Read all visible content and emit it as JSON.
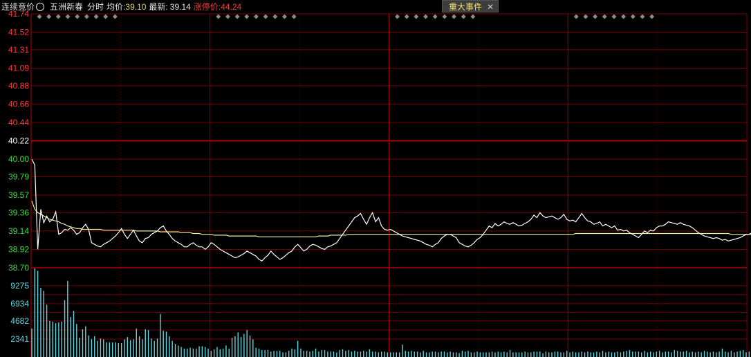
{
  "header": {
    "mode": "连续竞价",
    "stock_name": "五洲新春",
    "period": "分时",
    "avg_label": "均价:",
    "avg_value": "39.10",
    "last_label": "最新:",
    "last_value": "39.14",
    "limit_label": "涨停价:",
    "limit_value": "44.24",
    "event_button": "重大事件",
    "info_icon": "info-circle-icon",
    "close_icon": "close-icon"
  },
  "colors": {
    "up": "#ff3a3a",
    "down": "#3cdc3c",
    "neutral": "#ffffff",
    "price_line": "#ffffff",
    "avg_line": "#f0f0a0",
    "volume": "#5fd8e0",
    "grid": "#7a0000"
  },
  "chart_data": {
    "type": "line",
    "prev_close": 40.22,
    "price_ticks": [
      "41.74",
      "41.52",
      "41.31",
      "41.09",
      "40.88",
      "40.66",
      "40.44",
      "40.22",
      "40.00",
      "39.79",
      "39.57",
      "39.36",
      "39.14",
      "38.92",
      "38.70"
    ],
    "ylim": [
      38.7,
      41.74
    ],
    "volume_ticks": [
      "9275",
      "6934",
      "4682",
      "2341"
    ],
    "volume_ylim": [
      0,
      11600
    ],
    "minutes": 240,
    "series": [
      {
        "values": [
          40.0,
          39.93,
          38.92,
          39.4,
          39.24,
          39.32,
          39.25,
          39.28,
          39.37,
          39.1,
          39.12,
          39.16,
          39.15,
          39.18,
          39.15,
          39.1,
          39.12,
          39.18,
          39.22,
          39.16,
          39.0,
          38.98,
          38.96,
          38.95,
          38.98,
          39.0,
          39.02,
          39.05,
          39.08,
          39.12,
          39.17,
          39.1,
          39.05,
          39.1,
          39.15,
          39.08,
          39.02,
          39.0,
          39.05,
          39.06,
          39.1,
          39.12,
          39.14,
          39.18,
          39.2,
          39.14,
          39.1,
          39.05,
          39.02,
          39.0,
          38.98,
          38.95,
          38.95,
          38.98,
          39.0,
          38.97,
          38.95,
          38.95,
          38.92,
          38.95,
          39.0,
          38.98,
          38.95,
          38.92,
          38.9,
          38.88,
          38.86,
          38.84,
          38.82,
          38.83,
          38.85,
          38.87,
          38.9,
          38.88,
          38.86,
          38.84,
          38.8,
          38.78,
          38.82,
          38.85,
          38.9,
          38.86,
          38.83,
          38.8,
          38.82,
          38.85,
          38.88,
          38.9,
          38.95,
          38.98,
          38.94,
          38.9,
          38.92,
          38.96,
          38.98,
          38.97,
          38.95,
          38.93,
          38.92,
          38.95,
          38.96,
          38.98,
          39.0,
          39.05,
          39.1,
          39.15,
          39.2,
          39.25,
          39.3,
          39.32,
          39.35,
          39.28,
          39.22,
          39.3,
          39.36,
          39.25,
          39.3,
          39.2,
          39.16,
          39.15,
          39.16,
          39.14,
          39.12,
          39.1,
          39.08,
          39.07,
          39.06,
          39.05,
          39.04,
          39.03,
          39.02,
          39.0,
          38.98,
          38.97,
          38.95,
          38.98,
          39.0,
          39.05,
          39.08,
          39.1,
          39.1,
          39.08,
          39.06,
          39.0,
          38.98,
          38.96,
          38.95,
          38.97,
          39.0,
          39.04,
          39.06,
          39.1,
          39.15,
          39.2,
          39.18,
          39.23,
          39.2,
          39.22,
          39.25,
          39.23,
          39.22,
          39.24,
          39.22,
          39.2,
          39.21,
          39.23,
          39.25,
          39.28,
          39.33,
          39.3,
          39.36,
          39.32,
          39.3,
          39.31,
          39.32,
          39.3,
          39.28,
          39.3,
          39.34,
          39.28,
          39.26,
          39.27,
          39.25,
          39.3,
          39.35,
          39.3,
          39.26,
          39.25,
          39.22,
          39.23,
          39.25,
          39.2,
          39.22,
          39.2,
          39.18,
          39.2,
          39.15,
          39.16,
          39.14,
          39.15,
          39.12,
          39.1,
          39.08,
          39.06,
          39.1,
          39.14,
          39.12,
          39.15,
          39.14,
          39.18,
          39.2,
          39.2,
          39.22,
          39.25,
          39.24,
          39.23,
          39.22,
          39.24,
          39.22,
          39.21,
          39.2,
          39.18,
          39.15,
          39.12,
          39.1,
          39.08,
          39.07,
          39.06,
          39.05,
          39.06,
          39.05,
          39.03,
          39.04,
          39.02,
          39.03,
          39.04,
          39.05,
          39.06,
          39.08,
          39.1,
          39.1,
          39.12,
          39.14
        ]
      },
      {
        "values": [
          39.5,
          39.4,
          39.36,
          39.34,
          39.32,
          39.3,
          39.28,
          39.27,
          39.26,
          39.25,
          39.23,
          39.22,
          39.2,
          39.19,
          39.18,
          39.17,
          39.17,
          39.16,
          39.16,
          39.16,
          39.16,
          39.16,
          39.16,
          39.16,
          39.15,
          39.15,
          39.15,
          39.15,
          39.15,
          39.15,
          39.15,
          39.15,
          39.15,
          39.15,
          39.15,
          39.14,
          39.14,
          39.14,
          39.14,
          39.14,
          39.14,
          39.14,
          39.14,
          39.13,
          39.13,
          39.13,
          39.13,
          39.13,
          39.13,
          39.13,
          39.12,
          39.12,
          39.12,
          39.12,
          39.11,
          39.11,
          39.11,
          39.1,
          39.1,
          39.1,
          39.1,
          39.09,
          39.09,
          39.09,
          39.09,
          39.09,
          39.08,
          39.08,
          39.08,
          39.08,
          39.08,
          39.08,
          39.08,
          39.08,
          39.08,
          39.08,
          39.07,
          39.07,
          39.07,
          39.07,
          39.07,
          39.07,
          39.07,
          39.07,
          39.07,
          39.07,
          39.07,
          39.07,
          39.07,
          39.07,
          39.07,
          39.07,
          39.07,
          39.07,
          39.07,
          39.07,
          39.08,
          39.08,
          39.08,
          39.08,
          39.09,
          39.09,
          39.09,
          39.09,
          39.09,
          39.09,
          39.1,
          39.1,
          39.1,
          39.1,
          39.1,
          39.1,
          39.1,
          39.1,
          39.1,
          39.1,
          39.1,
          39.1,
          39.1,
          39.1,
          39.1,
          39.1,
          39.1,
          39.1,
          39.1,
          39.1,
          39.1,
          39.1,
          39.1,
          39.1,
          39.1,
          39.1,
          39.1,
          39.1,
          39.1,
          39.1,
          39.1,
          39.1,
          39.1,
          39.1,
          39.1,
          39.1,
          39.1,
          39.1,
          39.1,
          39.1,
          39.1,
          39.1,
          39.1,
          39.1,
          39.1,
          39.1,
          39.1,
          39.1,
          39.1,
          39.1,
          39.1,
          39.1,
          39.1,
          39.1,
          39.1,
          39.1,
          39.1,
          39.1,
          39.1,
          39.1,
          39.1,
          39.1,
          39.1,
          39.1,
          39.1,
          39.1,
          39.1,
          39.1,
          39.1,
          39.1,
          39.1,
          39.1,
          39.1,
          39.1,
          39.1,
          39.1,
          39.11,
          39.11,
          39.11,
          39.11,
          39.11,
          39.11,
          39.11,
          39.11,
          39.11,
          39.11,
          39.11,
          39.11,
          39.11,
          39.11,
          39.11,
          39.11,
          39.11,
          39.11,
          39.11,
          39.11,
          39.11,
          39.11,
          39.11,
          39.11,
          39.11,
          39.11,
          39.11,
          39.11,
          39.11,
          39.11,
          39.11,
          39.11,
          39.11,
          39.11,
          39.11,
          39.11,
          39.11,
          39.11,
          39.11,
          39.11,
          39.11,
          39.11,
          39.11,
          39.11,
          39.11,
          39.11,
          39.11,
          39.11,
          39.11,
          39.11,
          39.11,
          39.11,
          39.1,
          39.1,
          39.1,
          39.1,
          39.1,
          39.1,
          39.1,
          39.1,
          39.1,
          39.1
        ]
      }
    ],
    "volume": [
      3700,
      11500,
      11200,
      9000,
      8600,
      6800,
      4700,
      4600,
      4400,
      4500,
      4600,
      7400,
      9900,
      5200,
      6000,
      4300,
      2500,
      3600,
      4000,
      2800,
      2300,
      2700,
      2100,
      2400,
      2300,
      1900,
      1900,
      1900,
      1900,
      1800,
      1800,
      2300,
      2600,
      2200,
      2300,
      3700,
      2700,
      2300,
      3600,
      3500,
      2400,
      2100,
      2400,
      5600,
      3400,
      3300,
      2700,
      2100,
      1700,
      1500,
      1300,
      1100,
      1100,
      1200,
      1100,
      1100,
      1400,
      1400,
      1300,
      1100,
      800,
      1000,
      1300,
      1000,
      1100,
      1500,
      1100,
      2500,
      2700,
      3200,
      2600,
      3000,
      3500,
      2800,
      2300,
      1200,
      1100,
      900,
      900,
      900,
      700,
      800,
      800,
      800,
      600,
      600,
      800,
      1100,
      1000,
      2100,
      1100,
      800,
      800,
      700,
      800,
      1100,
      700,
      900,
      900,
      700,
      700,
      700,
      600,
      900,
      1000,
      800,
      900,
      700,
      800,
      700,
      700,
      800,
      700,
      1000,
      700,
      700,
      600,
      700,
      700,
      600,
      600,
      600,
      600,
      600,
      1600,
      800,
      700,
      800,
      700,
      700,
      600,
      800,
      600,
      600,
      700,
      700,
      600,
      700,
      700,
      600,
      700,
      600,
      600,
      500,
      800,
      700,
      800,
      600,
      600,
      700,
      600,
      600,
      600,
      600,
      700,
      600,
      700,
      600,
      700,
      600,
      900,
      600,
      600,
      600,
      600,
      700,
      600,
      600,
      700,
      700,
      700,
      500,
      700,
      600,
      600,
      700,
      700,
      600,
      600,
      800,
      600,
      700,
      600,
      600,
      700,
      600,
      700,
      600,
      600,
      700,
      600,
      800,
      600,
      700,
      600,
      600,
      700,
      600,
      700,
      800,
      900,
      700,
      700,
      700,
      600,
      800,
      600,
      700,
      600,
      700,
      800,
      600,
      700,
      700,
      600,
      900,
      800,
      700,
      700,
      800,
      600,
      700,
      600,
      700,
      600,
      800,
      700,
      600,
      700,
      600,
      700,
      1100,
      700,
      600,
      800,
      600,
      700,
      800,
      900,
      600,
      700,
      800,
      600,
      700,
      900,
      800,
      1200
    ],
    "event_markers_per_hour": [
      9,
      9,
      9,
      9
    ]
  }
}
